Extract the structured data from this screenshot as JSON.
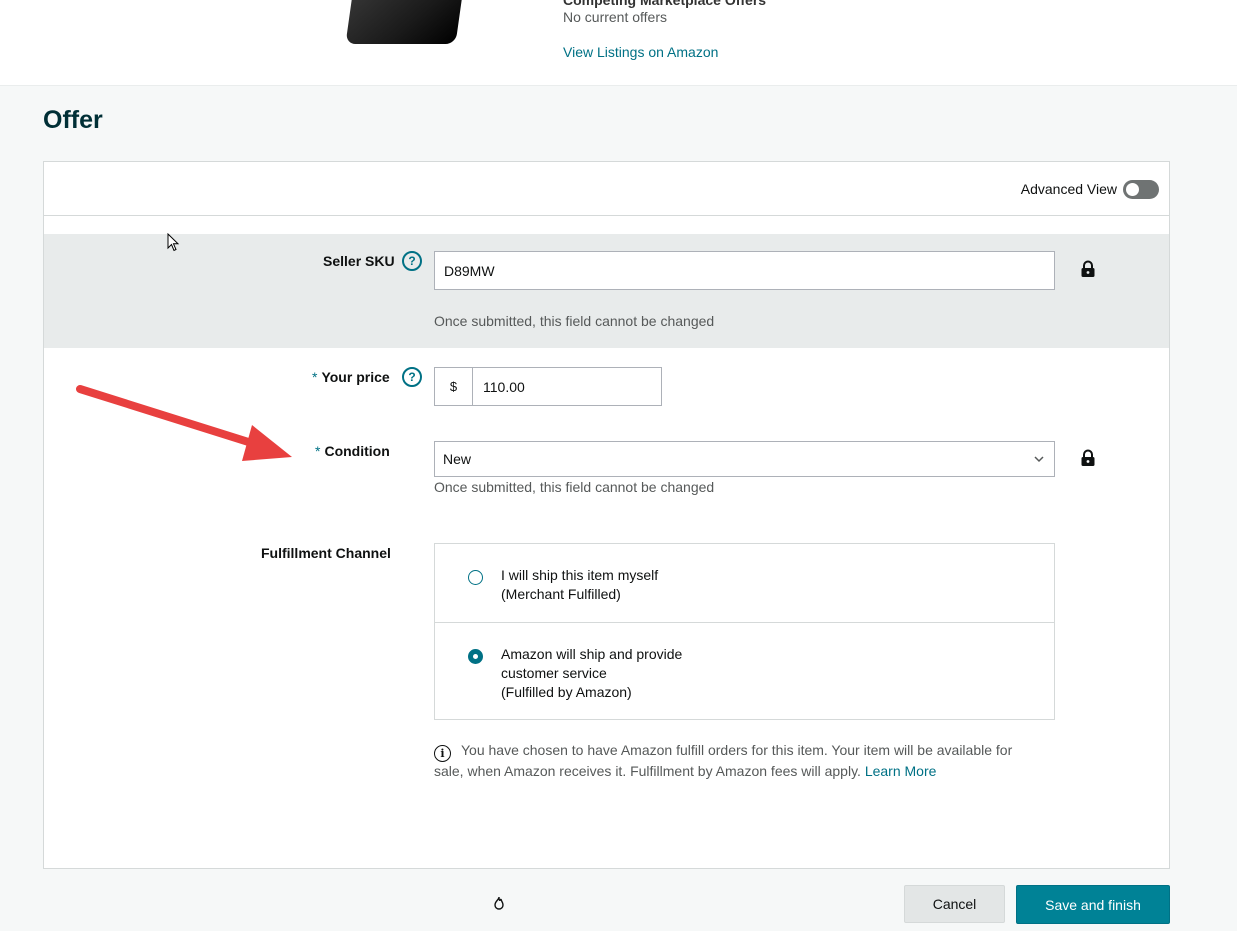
{
  "product": {
    "competing_title": "Competing Marketplace Offers",
    "no_offers": "No current offers",
    "view_listings": "View Listings on Amazon"
  },
  "page_title": "Offer",
  "card": {
    "advanced_view_label": "Advanced View",
    "advanced_view_on": false
  },
  "seller_sku": {
    "label": "Seller SKU",
    "value": "D89MW",
    "hint": "Once submitted, this field cannot be changed"
  },
  "price": {
    "required": "*",
    "label": "Your price",
    "currency": "$",
    "value": "110.00"
  },
  "condition": {
    "required": "*",
    "label": "Condition",
    "value": "New",
    "hint": "Once submitted, this field cannot be changed"
  },
  "fulfillment": {
    "label": "Fulfillment Channel",
    "options": [
      {
        "line1": "I will ship this item myself",
        "line2": "(Merchant Fulfilled)",
        "line3": "",
        "selected": false
      },
      {
        "line1": "Amazon will ship and provide",
        "line2": "customer service",
        "line3": "(Fulfilled by Amazon)",
        "selected": true
      }
    ],
    "info_text": "You have chosen to have Amazon fulfill orders for this item. Your item will be available for sale, when Amazon receives it. Fulfillment by Amazon fees will apply.",
    "learn_more": "Learn More"
  },
  "buttons": {
    "cancel": "Cancel",
    "save": "Save and finish"
  },
  "colors": {
    "accent": "#007185",
    "primary_button": "#008296",
    "annotation_arrow": "#e8403f"
  },
  "icons": [
    "help-icon",
    "lock-icon",
    "chevron-down-icon",
    "info-icon",
    "flame-icon",
    "mouse-cursor-icon",
    "annotation-arrow"
  ]
}
